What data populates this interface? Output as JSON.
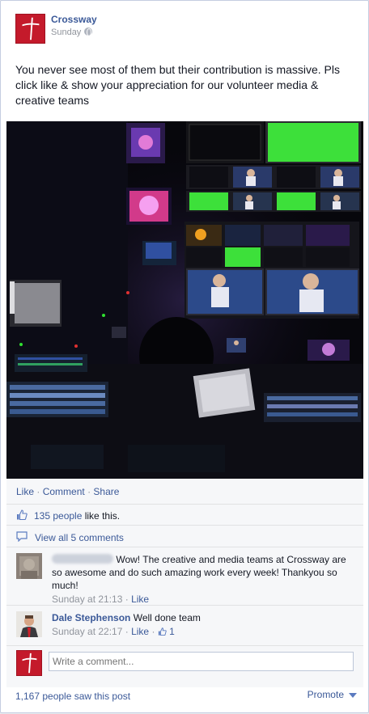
{
  "post": {
    "page_name": "Crossway",
    "timestamp": "Sunday",
    "text": "You never see most of them but their contribution is massive. Pls click like & show your appreciation for our volunteer media & creative teams",
    "photo_subject": "broadcast-control-room-monitors"
  },
  "actions": {
    "like": "Like",
    "comment": "Comment",
    "share": "Share",
    "separator": "·"
  },
  "likes": {
    "count_label": "135 people",
    "suffix": " like this."
  },
  "comments_link": "View all 5 comments",
  "comments": [
    {
      "author": "",
      "text": "Wow! The creative and media teams at Crossway are so awesome and do such amazing work every week! Thankyou so much!",
      "time": "Sunday at 21:13",
      "like_label": "Like"
    },
    {
      "author": "Dale Stephenson",
      "text": "Well done team",
      "time": "Sunday at 22:17",
      "like_label": "Like",
      "like_count": "1"
    }
  ],
  "composer": {
    "placeholder": "Write a comment..."
  },
  "footer": {
    "seen": "1,167 people saw this post",
    "promote": "Promote"
  },
  "colors": {
    "brand": "#3b5998",
    "avatar_red": "#c41a2b",
    "monitor_green": "#3de03a"
  },
  "icons": {
    "privacy": "globe-icon",
    "likes": "thumbs-up-icon",
    "comments": "speech-bubble-icon",
    "promote": "chevron-down-icon"
  }
}
